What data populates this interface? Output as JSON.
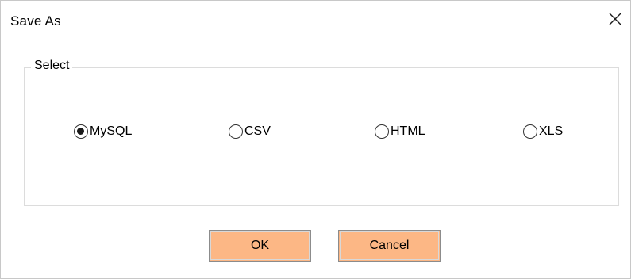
{
  "window": {
    "title": "Save As"
  },
  "group": {
    "legend": "Select",
    "options": [
      {
        "label": "MySQL",
        "checked": true
      },
      {
        "label": "CSV",
        "checked": false
      },
      {
        "label": "HTML",
        "checked": false
      },
      {
        "label": "XLS",
        "checked": false
      }
    ]
  },
  "buttons": {
    "ok_label": "OK",
    "cancel_label": "Cancel"
  },
  "icons": {
    "close": "close-icon"
  },
  "colors": {
    "button_bg": "#fcb785",
    "window_bg": "#ffffff"
  }
}
